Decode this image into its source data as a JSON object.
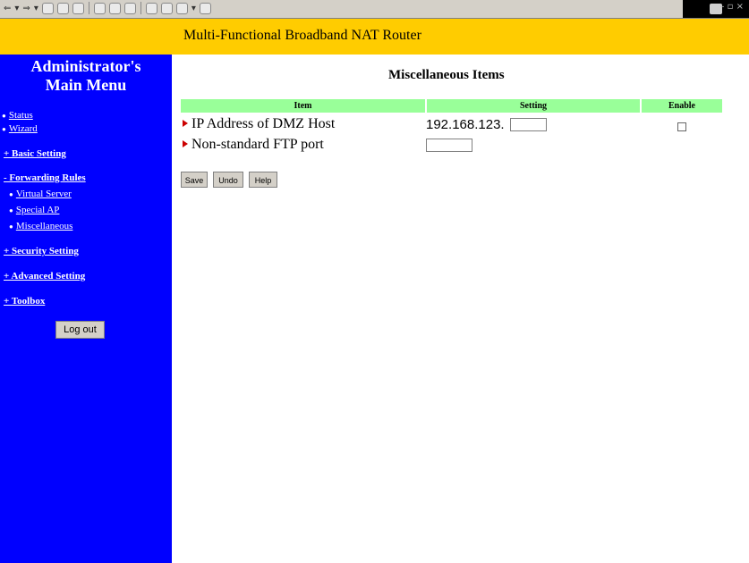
{
  "banner": {
    "title": "Multi-Functional Broadband NAT Router"
  },
  "sidebar": {
    "title_line1": "Administrator's",
    "title_line2": "Main Menu",
    "items": [
      {
        "label": "Status"
      },
      {
        "label": "Wizard"
      },
      {
        "label": "+ Basic Setting"
      },
      {
        "label": "- Forwarding Rules"
      },
      {
        "label": "Virtual Server"
      },
      {
        "label": "Special AP"
      },
      {
        "label": "Miscellaneous"
      },
      {
        "label": "+ Security Setting"
      },
      {
        "label": "+ Advanced Setting"
      },
      {
        "label": "+ Toolbox"
      }
    ],
    "logout_label": "Log out"
  },
  "main": {
    "title": "Miscellaneous Items",
    "columns": {
      "item": "Item",
      "setting": "Setting",
      "enable": "Enable"
    },
    "rows": [
      {
        "label": "IP Address of DMZ Host",
        "prefix": "192.168.123.",
        "value": "",
        "enabled": false
      },
      {
        "label": "Non-standard FTP port",
        "value": ""
      }
    ],
    "buttons": {
      "save": "Save",
      "undo": "Undo",
      "help": "Help"
    }
  }
}
